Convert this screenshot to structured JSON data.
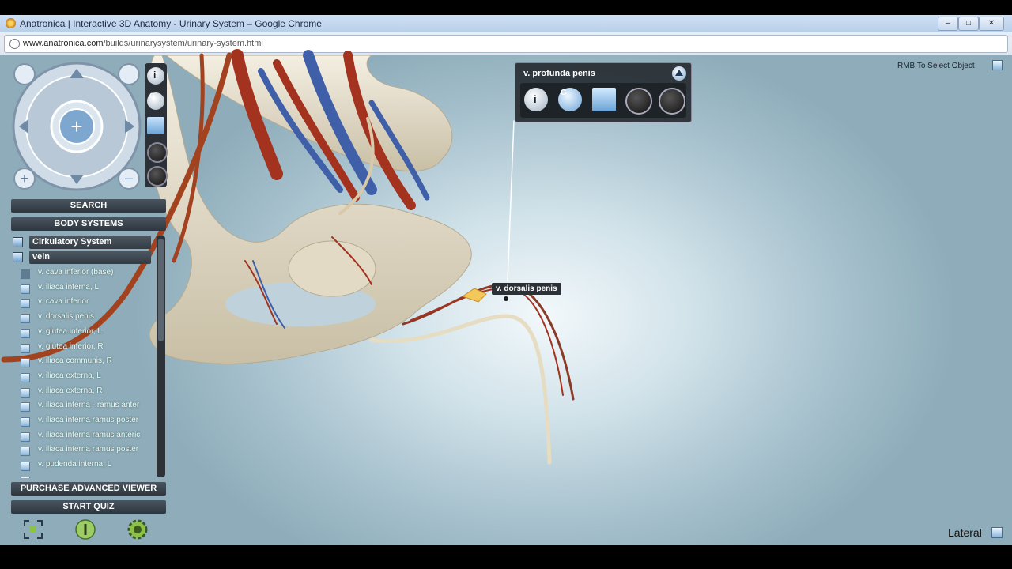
{
  "window": {
    "title": "Anatronica | Interactive 3D Anatomy - Urinary System – Google Chrome",
    "controls": [
      "–",
      "□",
      "✕"
    ]
  },
  "address": {
    "domain": "www.anatronica.com",
    "path": "/builds/urinarysystem/urinary-system.html"
  },
  "view_controls": {
    "info": "i",
    "ghost": "G"
  },
  "panel": {
    "search_label": "SEARCH",
    "body_systems_label": "BODY SYSTEMS",
    "tree_headers": [
      "Cirkulatory System",
      "vein"
    ],
    "items": [
      "v. cava inferior (base)",
      "v. iliaca interna, L",
      "v. cava inferior",
      "v. dorsalis penis",
      "v. glutea inferior, L",
      "v. glutea inferior, R",
      "v. iliaca communis, R",
      "v. iliaca externa, L",
      "v. iliaca externa, R",
      "v. iliaca interna - ramus anter",
      "v. iliaca interna ramus poster",
      "v. iliaca interna ramus anteric",
      "v. iliaca interna ramus poster",
      "v. pudenda interna, L"
    ],
    "purchase_label": "PURCHASE ADVANCED VIEWER",
    "quiz_label": "START QUIZ"
  },
  "info_panel": {
    "name": "v. profunda penis",
    "info": "i",
    "ghost": "G"
  },
  "tooltip": "v. dorsalis penis",
  "rmb_hint": "RMB To Select Object",
  "view_name": "Lateral",
  "colors": {
    "accent": "#7ea7cf",
    "panel": "#2e363e",
    "vein": "#3f5fa8",
    "artery": "#a3321e",
    "bone": "#e8e1cf"
  }
}
